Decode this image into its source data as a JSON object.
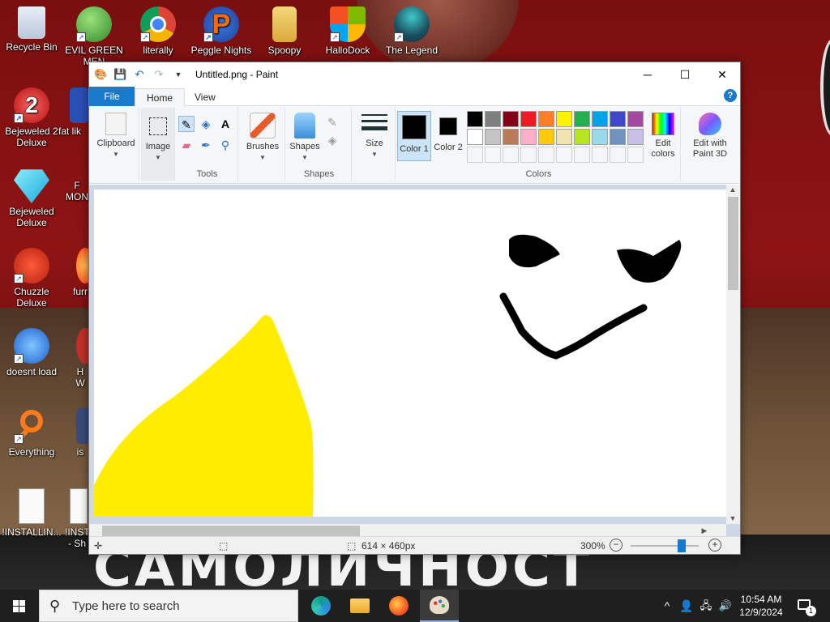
{
  "desktop": {
    "icons": [
      {
        "label": "Recycle Bin"
      },
      {
        "label": "EVIL GREEN MEN"
      },
      {
        "label": "literally"
      },
      {
        "label": "Peggle Nights"
      },
      {
        "label": "Spoopy"
      },
      {
        "label": "HalloDock"
      },
      {
        "label": "The Legend"
      },
      {
        "label": "Bejeweled 2 Deluxe"
      },
      {
        "label": "fat lik"
      },
      {
        "label": "Bejeweled Deluxe"
      },
      {
        "label": "F MON"
      },
      {
        "label": "Chuzzle Deluxe"
      },
      {
        "label": "furr"
      },
      {
        "label": "doesnt load"
      },
      {
        "label": "H W"
      },
      {
        "label": "Everything"
      },
      {
        "label": "is"
      },
      {
        "label": "!INSTALLIN..."
      },
      {
        "label": "!INST - Sh"
      }
    ],
    "wallpaper_text": "САМОЛИЧНОСТ"
  },
  "window": {
    "title": "Untitled.png - Paint",
    "tabs": [
      "File",
      "Home",
      "View"
    ],
    "help_label": "?",
    "ribbon": {
      "clipboard": "Clipboard",
      "image": "Image",
      "tools_group": "Tools",
      "brushes": "Brushes",
      "shapes": "Shapes",
      "shapes_group": "Shapes",
      "size": "Size",
      "color1": "Color 1",
      "color2": "Color 2",
      "colors_group": "Colors",
      "edit_colors": "Edit colors",
      "edit_paint3d": "Edit with Paint 3D"
    },
    "palette_row1": [
      "#000000",
      "#7f7f7f",
      "#880015",
      "#ed1c24",
      "#ff7f27",
      "#fff200",
      "#22b14c",
      "#00a2e8",
      "#3f48cc",
      "#a349a4"
    ],
    "palette_row2": [
      "#ffffff",
      "#c3c3c3",
      "#b97a57",
      "#ffaec9",
      "#ffc90e",
      "#efe4b0",
      "#b5e61d",
      "#99d9ea",
      "#7092be",
      "#c8bfe7"
    ],
    "color1_value": "#000000",
    "color2_value": "#000000",
    "status": {
      "dimensions": "614 × 460px",
      "zoom": "300%",
      "zoom_level": 0.75
    }
  },
  "taskbar": {
    "search_placeholder": "Type here to search",
    "time": "10:54 AM",
    "date": "12/9/2024",
    "notification_count": "1"
  }
}
